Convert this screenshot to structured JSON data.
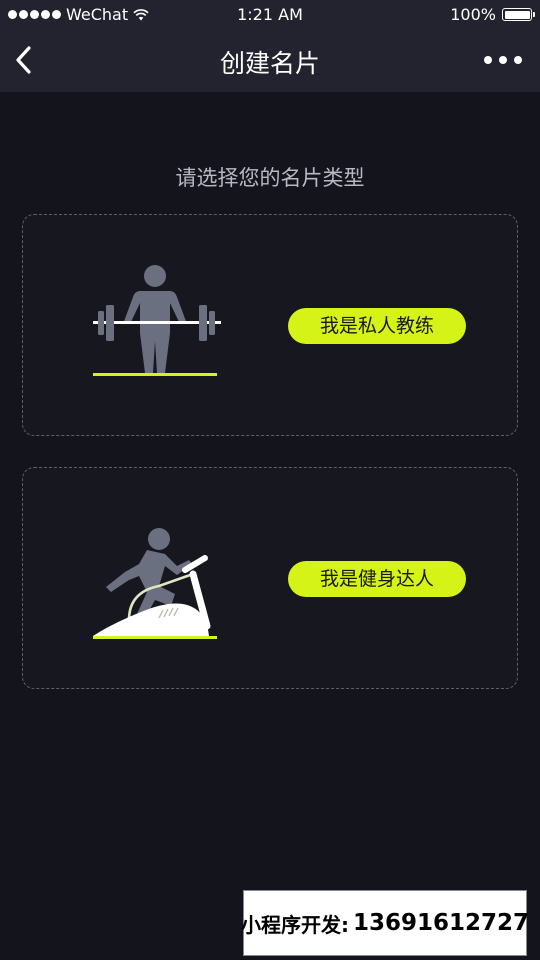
{
  "status_bar": {
    "carrier": "WeChat",
    "time": "1:21 AM",
    "battery": "100%"
  },
  "nav": {
    "title": "创建名片"
  },
  "main": {
    "prompt": "请选择您的名片类型",
    "cards": [
      {
        "label": "我是私人教练",
        "icon": "weightlifter-icon"
      },
      {
        "label": "我是健身达人",
        "icon": "treadmill-runner-icon"
      }
    ]
  },
  "watermark": {
    "prefix": "小程序开发:",
    "phone": "13691612727"
  },
  "colors": {
    "accent": "#d5f317",
    "background": "#14141c",
    "header": "#22232e",
    "figure": "#6b7080"
  }
}
